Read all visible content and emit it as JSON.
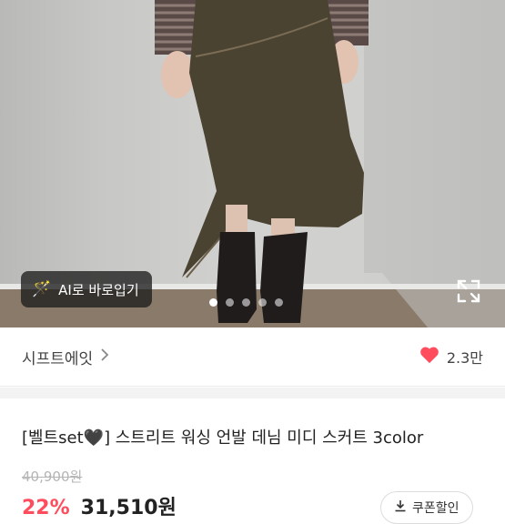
{
  "photo": {
    "ai_button_label": "AI로 바로입기",
    "ai_icon": "magic-wand-icon",
    "expand_icon": "expand-icon",
    "carousel_dots": 5,
    "active_dot": 1
  },
  "shop": {
    "name": "시프트에잇",
    "chevron_icon": "chevron-right-icon",
    "likes_icon": "heart-icon",
    "likes_count": "2.3만",
    "heart_color": "#ff4d5e"
  },
  "product": {
    "title": "[벨트set🖤] 스트리트 워싱 언발 데님 미디 스커트 3color",
    "original_price": "40,900원",
    "discount": "22%",
    "price": "31,510원",
    "coupon_label": "쿠폰할인"
  },
  "colors": {
    "accent": "#ff4d5e"
  }
}
